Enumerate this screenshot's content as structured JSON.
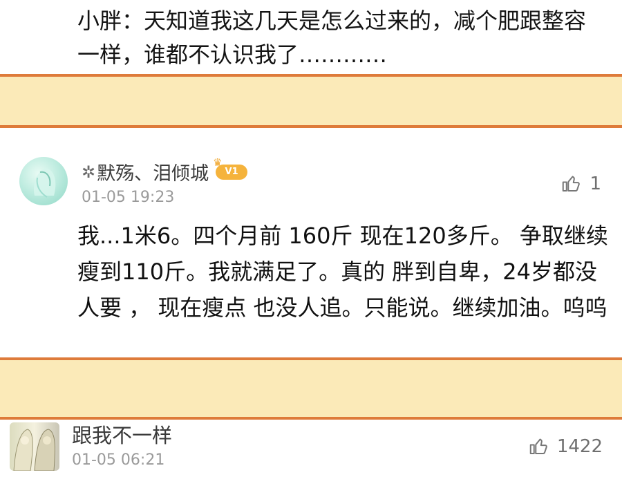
{
  "top_text": "小胖：天知道我这几天是怎么过来的，减个肥跟整容一样，谁都不认识我了…………",
  "comments": [
    {
      "username": "默殇、泪倾城",
      "badge": "V1",
      "time": "01-05 19:23",
      "likes": "1",
      "text": "我...1米6。四个月前 160斤  现在120多斤。 争取继续瘦到110斤。我就满足了。真的 胖到自卑，24岁都没人要 ， 现在瘦点 也没人追。只能说。继续加油。呜呜"
    },
    {
      "username": "跟我不一样",
      "time": "01-05 06:21",
      "likes": "1422"
    }
  ],
  "colors": {
    "band_fill": "#fbeab8",
    "band_border": "#de7b3a"
  },
  "icons": {
    "flower": "flower-icon",
    "like": "thumbs-up-icon",
    "vip": "vip-crown-icon"
  }
}
